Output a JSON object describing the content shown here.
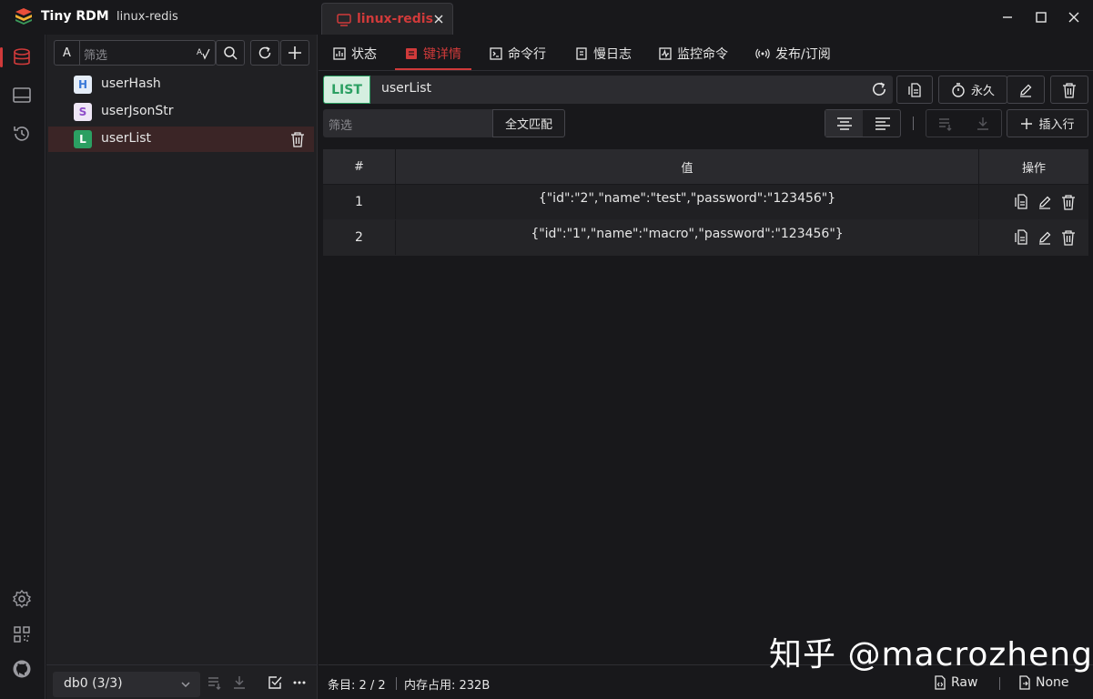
{
  "app": {
    "title": "Tiny RDM",
    "connection": "linux-redis"
  },
  "tab": {
    "label": "linux-redis"
  },
  "sidebar": {
    "filter_case": "A",
    "filter_placeholder": "筛选",
    "keys": [
      {
        "type": "H",
        "name": "userHash",
        "badge_bg": "#e5edf8",
        "badge_fg": "#3b7ad8"
      },
      {
        "type": "S",
        "name": "userJsonStr",
        "badge_bg": "#eee6f6",
        "badge_fg": "#8e4cc9"
      },
      {
        "type": "L",
        "name": "userList",
        "badge_bg": "#2b9f62",
        "badge_fg": "#ffffff"
      }
    ],
    "db": "db0 (3/3)"
  },
  "subtabs": [
    {
      "label": "状态",
      "icon": "status-icon"
    },
    {
      "label": "键详情",
      "icon": "key-detail-icon"
    },
    {
      "label": "命令行",
      "icon": "terminal-icon"
    },
    {
      "label": "慢日志",
      "icon": "slowlog-icon"
    },
    {
      "label": "监控命令",
      "icon": "monitor-icon"
    },
    {
      "label": "发布/订阅",
      "icon": "pubsub-icon"
    }
  ],
  "key_detail": {
    "type": "LIST",
    "key": "userList",
    "ttl_label": "永久",
    "value_filter_placeholder": "筛选",
    "fulltext_label": "全文匹配",
    "insert_label": "插入行"
  },
  "table": {
    "headers": {
      "index": "#",
      "value": "值",
      "ops": "操作"
    },
    "rows": [
      {
        "index": "1",
        "value": "{\"id\":\"2\",\"name\":\"test\",\"password\":\"123456\"}"
      },
      {
        "index": "2",
        "value": "{\"id\":\"1\",\"name\":\"macro\",\"password\":\"123456\"}"
      }
    ]
  },
  "status": {
    "entries": "条目: 2 / 2",
    "memory": "内存占用: 232B",
    "format": "Raw",
    "decode": "None"
  },
  "watermark": "知乎 @macrozheng",
  "colors": {
    "accent": "#d03a3a",
    "list_green": "#2b9f62"
  }
}
